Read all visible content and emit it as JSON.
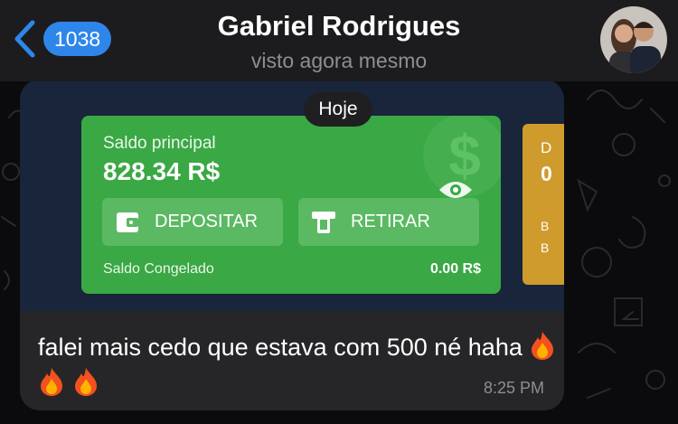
{
  "header": {
    "unread_count": "1038",
    "contact_name": "Gabriel Rodrigues",
    "status": "visto agora mesmo"
  },
  "date_separator": "Hoje",
  "screenshot": {
    "balance_label": "Saldo principal",
    "balance_value": "828.34 R$",
    "deposit_label": "DEPOSITAR",
    "withdraw_label": "RETIRAR",
    "frozen_label": "Saldo Congelado",
    "frozen_value": "0.00 R$",
    "side_card": {
      "t1": "D",
      "t2": "0",
      "b1": "B",
      "b2": "B"
    },
    "colors": {
      "card_green": "#3aa845",
      "side_gold": "#cf9b2c",
      "app_bg": "#18253a"
    }
  },
  "message": {
    "text": "falei mais cedo que estava com 500 né haha",
    "emojis": [
      "fire-emoji",
      "fire-emoji",
      "fire-emoji"
    ],
    "time": "8:25 PM"
  },
  "colors": {
    "accent": "#2f86ea",
    "header_bg": "#1c1c1e",
    "bubble_bg": "#262628"
  }
}
